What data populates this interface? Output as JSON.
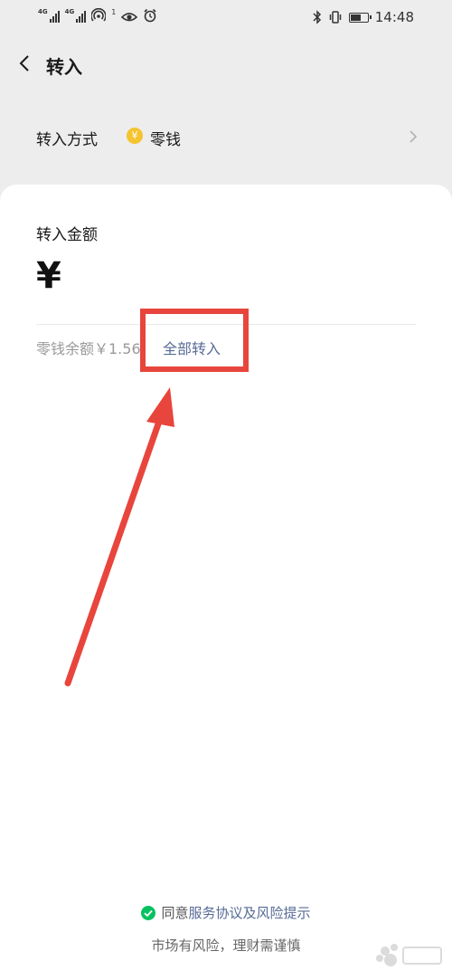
{
  "status_bar": {
    "network_1": "4G",
    "network_2": "4G",
    "notification_count": "1",
    "time": "14:48",
    "battery_level": 0.55
  },
  "nav": {
    "title": "转入",
    "back_icon": "chevron-left-icon"
  },
  "method": {
    "label": "转入方式",
    "coin_symbol": "¥",
    "value": "零钱"
  },
  "amount": {
    "label": "转入金额",
    "currency_symbol": "¥",
    "balance_text": "零钱余额￥1.56，",
    "transfer_all": "全部转入"
  },
  "annotation": {
    "color": "#e8453c"
  },
  "footer": {
    "agree_prefix": "同意",
    "agree_link": "服务协议及风险提示",
    "risk_notice": "市场有风险，理财需谨慎"
  },
  "colors": {
    "link": "#576b95",
    "check_green": "#07c160",
    "coin_gold": "#f5c330",
    "background": "#ededed"
  }
}
